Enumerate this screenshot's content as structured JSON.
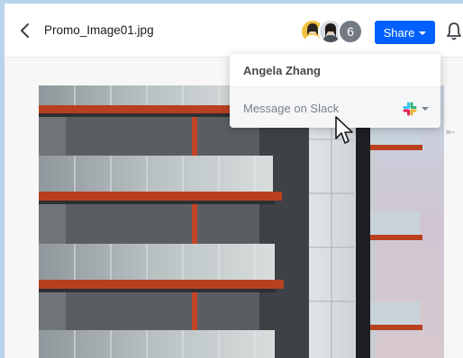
{
  "header": {
    "filename": "Promo_Image01.jpg",
    "collaborator_count": "6",
    "share_label": "Share"
  },
  "popover": {
    "person_name": "Angela Zhang",
    "action_label": "Message on Slack"
  },
  "icons": [
    "chevron-left-icon",
    "bell-icon",
    "slack-icon",
    "caret-down-icon",
    "collapse-arrow-icon"
  ],
  "colors": {
    "share_button": "#0061fe",
    "page_background": "#b9d3ea",
    "avatar_count_bg": "#737a84"
  }
}
